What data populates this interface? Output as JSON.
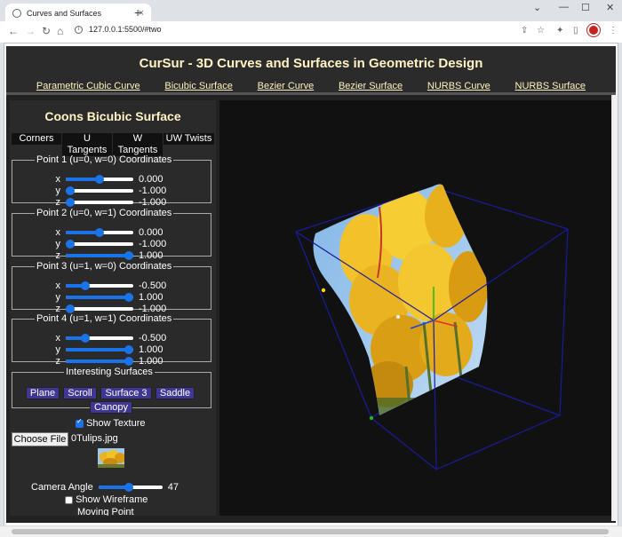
{
  "browser": {
    "tab_title": "Curves and Surfaces",
    "tab_close": "×",
    "new_tab": "+",
    "url": "127.0.0.1:5500/#two",
    "info_icon": "i",
    "win_min": "⌄",
    "win_min2": "—",
    "win_max": "☐",
    "win_close": "✕",
    "nav_back": "←",
    "nav_forward": "→",
    "nav_reload": "↻",
    "nav_home": "⌂",
    "tb_share": "⇪",
    "tb_star": "☆",
    "tb_ext": "✦",
    "tb_sidebar": "▯",
    "tb_menu": "⋮"
  },
  "header": {
    "title": "CurSur - 3D Curves and Surfaces in Geometric Design",
    "links": [
      "Parametric Cubic Curve",
      "Bicubic Surface",
      "Bezier Curve",
      "Bezier Surface",
      "NURBS Curve",
      "NURBS Surface"
    ]
  },
  "panel": {
    "title": "Coons Bicubic Surface",
    "tabs": {
      "corners": "Corners",
      "u": "U",
      "u_sub": "Tangents",
      "w": "W",
      "w_sub": "Tangents",
      "uw": "UW Twists"
    },
    "points": [
      {
        "legend": "Point 1 (u=0, w=0) Coordinates",
        "x_label": "x",
        "y_label": "y",
        "z_label": "z",
        "x": "0.000",
        "y": "-1.000",
        "z": "-1.000",
        "x_level": 0.5,
        "y_level": 0.0,
        "z_level": 0.0
      },
      {
        "legend": "Point 2 (u=0, w=1) Coordinates",
        "x_label": "x",
        "y_label": "y",
        "z_label": "z",
        "x": "0.000",
        "y": "-1.000",
        "z": "1.000",
        "x_level": 0.5,
        "y_level": 0.0,
        "z_level": 1.0
      },
      {
        "legend": "Point 3 (u=1, w=0) Coordinates",
        "x_label": "x",
        "y_label": "y",
        "z_label": "z",
        "x": "-0.500",
        "y": "1.000",
        "z": "-1.000",
        "x_level": 0.25,
        "y_level": 1.0,
        "z_level": 0.0
      },
      {
        "legend": "Point 4 (u=1, w=1) Coordinates",
        "x_label": "x",
        "y_label": "y",
        "z_label": "z",
        "x": "-0.500",
        "y": "1.000",
        "z": "1.000",
        "x_level": 0.25,
        "y_level": 1.0,
        "z_level": 1.0
      }
    ],
    "interesting": {
      "legend": "Interesting Surfaces",
      "buttons": [
        "Plane",
        "Scroll",
        "Surface 3",
        "Saddle",
        "Canopy"
      ]
    },
    "show_texture": "Show Texture",
    "show_texture_checked": true,
    "choose_file": "Choose File",
    "file_name": "0Tulips.jpg",
    "camera_label": "Camera Angle",
    "camera_value": "47",
    "camera_level": 0.47,
    "show_wireframe": "Show Wireframe",
    "show_wireframe_checked": false,
    "moving_point": "Moving Point"
  },
  "colors": {
    "title_text": "#fff3c4",
    "accent_blue": "#1a73e8",
    "button_purple": "#3f3696",
    "box_lines": "#1a1aa0"
  }
}
